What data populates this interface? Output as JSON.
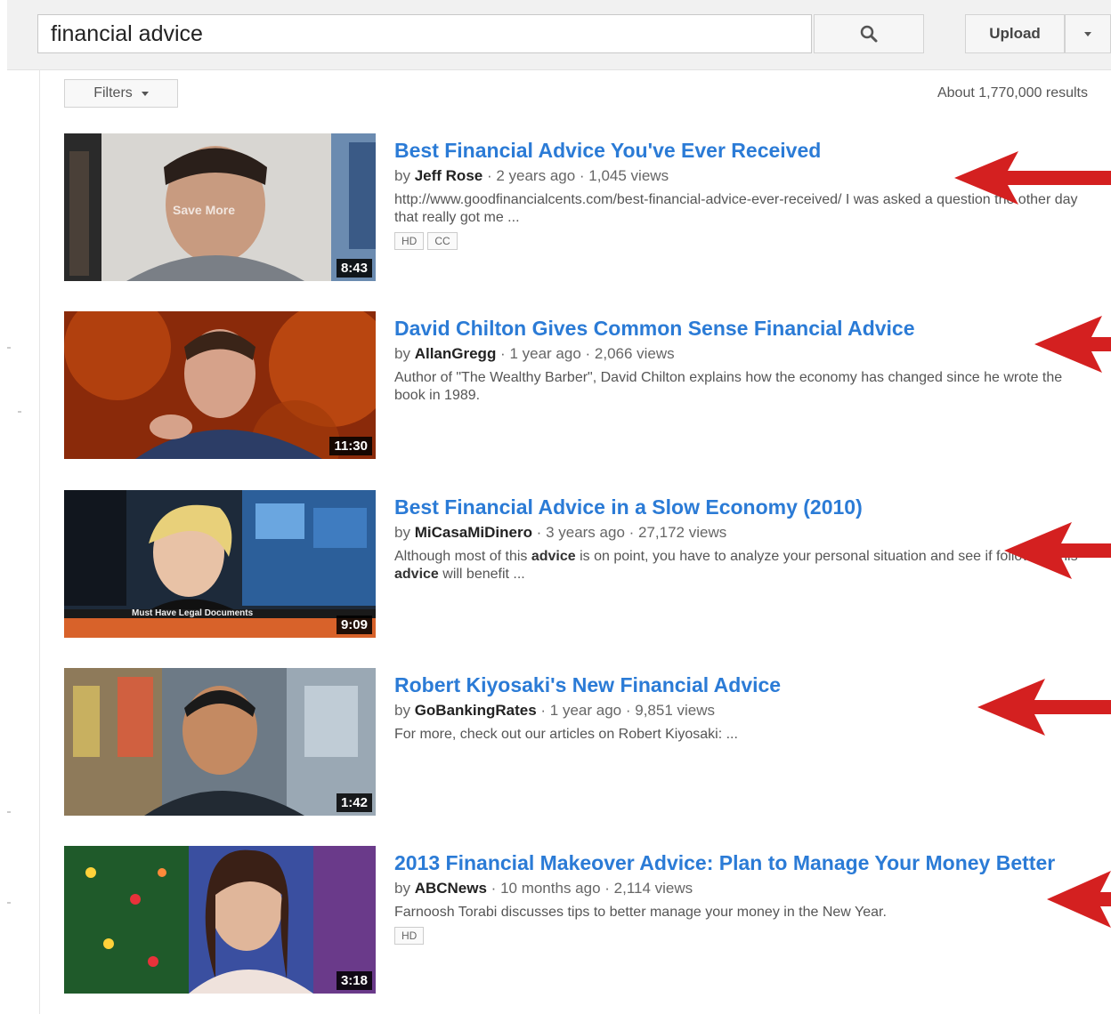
{
  "search": {
    "query": "financial advice"
  },
  "header": {
    "upload_label": "Upload"
  },
  "filters": {
    "label": "Filters"
  },
  "results_count": "About 1,770,000 results",
  "results": [
    {
      "title": "Best Financial Advice You've Ever Received",
      "by": "by",
      "channel": "Jeff Rose",
      "age": "2 years ago",
      "views": "1,045 views",
      "description": "http://www.goodfinancialcents.com/best-financial-advice-ever-received/ I was asked a question the other day that really got me ...",
      "badges": [
        "HD",
        "CC"
      ],
      "duration": "8:43",
      "thumb_overlay": "Save More"
    },
    {
      "title": "David Chilton Gives Common Sense Financial Advice",
      "by": "by",
      "channel": "AllanGregg",
      "age": "1 year ago",
      "views": "2,066 views",
      "description": "Author of \"The Wealthy Barber\", David Chilton explains how the economy has changed since he wrote the book in 1989.",
      "badges": [],
      "duration": "11:30"
    },
    {
      "title": "Best Financial Advice in a Slow Economy (2010)",
      "by": "by",
      "channel": "MiCasaMiDinero",
      "age": "3 years ago",
      "views": "27,172 views",
      "description_parts": [
        "Although most of this ",
        "advice",
        " is on point, you have to analyze your personal situation and see if following this ",
        "advice",
        " will benefit ..."
      ],
      "badges": [],
      "duration": "9:09",
      "thumb_overlay": "Must Have Legal Documents"
    },
    {
      "title": "Robert Kiyosaki's New Financial Advice",
      "by": "by",
      "channel": "GoBankingRates",
      "age": "1 year ago",
      "views": "9,851 views",
      "description": "For more, check out our articles on Robert Kiyosaki: ...",
      "badges": [],
      "duration": "1:42"
    },
    {
      "title": "2013 Financial Makeover Advice: Plan to Manage Your Money Better",
      "by": "by",
      "channel": "ABCNews",
      "age": "10 months ago",
      "views": "2,114 views",
      "description": "Farnoosh Torabi discusses tips to better manage your money in the New Year.",
      "badges": [
        "HD"
      ],
      "duration": "3:18"
    }
  ],
  "colors": {
    "link": "#2b7bd6",
    "arrow": "#d42020",
    "masthead": "#f1f1f1"
  },
  "icons": {
    "search": "search-icon",
    "dropdown": "chevron-down-icon",
    "annotation": "red-arrow-icon"
  }
}
